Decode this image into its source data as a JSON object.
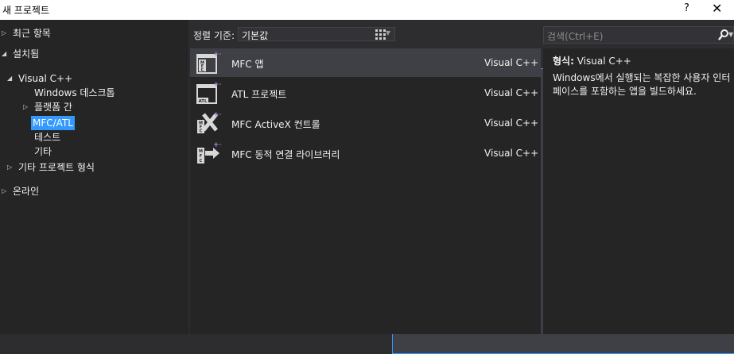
{
  "window": {
    "title": "새 프로젝트",
    "help_label": "?",
    "close_label": "✕"
  },
  "tree": {
    "recent": "최근 항목",
    "installed": "설치됨",
    "visual_cpp": "Visual C++",
    "windows_desktop": "Windows 데스크톱",
    "cross_platform": "플랫폼 간",
    "mfc_atl": "MFC/ATL",
    "test": "테스트",
    "other": "기타",
    "other_project_types": "기타 프로젝트 형식",
    "online": "온라인"
  },
  "toolbar": {
    "sort_label": "정렬 기준:",
    "sort_value": "기본값"
  },
  "search": {
    "placeholder": "검색(Ctrl+E)"
  },
  "templates": [
    {
      "name": "MFC 앱",
      "lang": "Visual C++",
      "icon": "mfc-app-icon"
    },
    {
      "name": "ATL 프로젝트",
      "lang": "Visual C++",
      "icon": "atl-project-icon"
    },
    {
      "name": "MFC ActiveX 컨트롤",
      "lang": "Visual C++",
      "icon": "mfc-activex-icon"
    },
    {
      "name": "MFC 동적 연결 라이브러리",
      "lang": "Visual C++",
      "icon": "mfc-dll-icon"
    }
  ],
  "details": {
    "type_key": "형식:",
    "type_value": "Visual C++",
    "description": "Windows에서 실행되는 복잡한 사용자 인터페이스를 포함하는 앱을 빌드하세요."
  },
  "colors": {
    "accent": "#3399ff",
    "plus": "#b180d7",
    "background": "#2d2d30"
  }
}
